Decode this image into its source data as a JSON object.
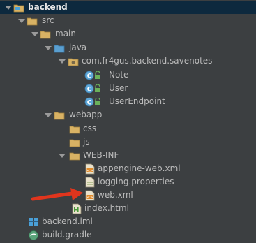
{
  "tree": [
    {
      "label": "backend",
      "icon": "module-folder-icon",
      "bold": true,
      "arrow": "expanded"
    },
    {
      "label": "src",
      "icon": "folder-icon",
      "arrow": "expanded"
    },
    {
      "label": "main",
      "icon": "folder-icon",
      "arrow": "expanded"
    },
    {
      "label": "java",
      "icon": "source-folder-icon",
      "arrow": "expanded"
    },
    {
      "label": "com.fr4gus.backend.savenotes",
      "icon": "package-icon",
      "arrow": "expanded"
    },
    {
      "label": "Note",
      "icon": "class-icon"
    },
    {
      "label": "User",
      "icon": "class-icon"
    },
    {
      "label": "UserEndpoint",
      "icon": "class-icon"
    },
    {
      "label": "webapp",
      "icon": "folder-icon",
      "arrow": "expanded"
    },
    {
      "label": "css",
      "icon": "folder-icon"
    },
    {
      "label": "js",
      "icon": "folder-icon"
    },
    {
      "label": "WEB-INF",
      "icon": "folder-icon",
      "arrow": "expanded"
    },
    {
      "label": "appengine-web.xml",
      "icon": "xml-file-icon"
    },
    {
      "label": "logging.properties",
      "icon": "properties-file-icon"
    },
    {
      "label": "web.xml",
      "icon": "xml-file-icon"
    },
    {
      "label": "index.html",
      "icon": "html-file-icon"
    },
    {
      "label": "backend.iml",
      "icon": "iml-file-icon"
    },
    {
      "label": "build.gradle",
      "icon": "gradle-file-icon"
    }
  ],
  "colors": {
    "background": "#3c3f41",
    "selection": "#0d293e",
    "text": "#bbbbbb",
    "folder": "#d8b264",
    "class_badge": "#5fa8d8",
    "callout_arrow": "#e0351d"
  }
}
